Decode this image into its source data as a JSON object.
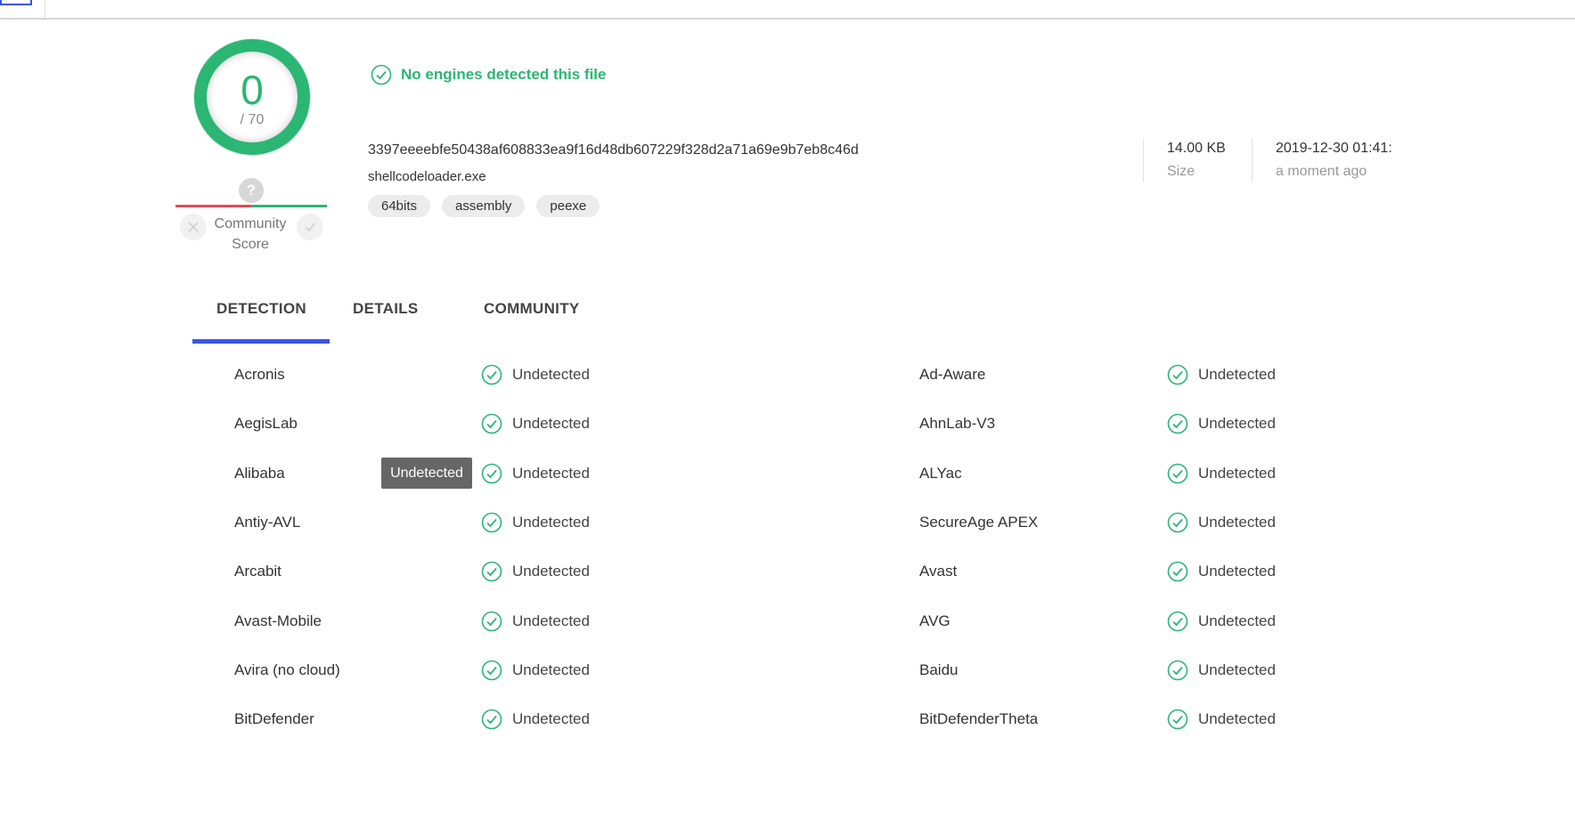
{
  "score": {
    "detected": "0",
    "total": "/ 70"
  },
  "community": {
    "label_line1": "Community",
    "label_line2": "Score",
    "question": "?"
  },
  "summary": {
    "message": "No engines detected this file"
  },
  "file": {
    "hash": "3397eeeebfe50438af608833ea9f16d48db607229f328d2a71a69e9b7eb8c46d",
    "name": "shellcodeloader.exe",
    "tags": [
      "64bits",
      "assembly",
      "peexe"
    ],
    "size_value": "14.00 KB",
    "size_label": "Size",
    "date_value": "2019-12-30 01:41:",
    "date_label": "a moment ago"
  },
  "tabs": [
    {
      "label": "DETECTION",
      "active": true
    },
    {
      "label": "DETAILS",
      "active": false
    },
    {
      "label": "COMMUNITY",
      "active": false
    }
  ],
  "tooltip": "Undetected",
  "detections": [
    {
      "left": {
        "engine": "Acronis",
        "result": "Undetected"
      },
      "right": {
        "engine": "Ad-Aware",
        "result": "Undetected"
      }
    },
    {
      "left": {
        "engine": "AegisLab",
        "result": "Undetected"
      },
      "right": {
        "engine": "AhnLab-V3",
        "result": "Undetected"
      }
    },
    {
      "left": {
        "engine": "Alibaba",
        "result": "Undetected"
      },
      "right": {
        "engine": "ALYac",
        "result": "Undetected"
      }
    },
    {
      "left": {
        "engine": "Antiy-AVL",
        "result": "Undetected"
      },
      "right": {
        "engine": "SecureAge APEX",
        "result": "Undetected"
      }
    },
    {
      "left": {
        "engine": "Arcabit",
        "result": "Undetected"
      },
      "right": {
        "engine": "Avast",
        "result": "Undetected"
      }
    },
    {
      "left": {
        "engine": "Avast-Mobile",
        "result": "Undetected"
      },
      "right": {
        "engine": "AVG",
        "result": "Undetected"
      }
    },
    {
      "left": {
        "engine": "Avira (no cloud)",
        "result": "Undetected"
      },
      "right": {
        "engine": "Baidu",
        "result": "Undetected"
      }
    },
    {
      "left": {
        "engine": "BitDefender",
        "result": "Undetected"
      },
      "right": {
        "engine": "BitDefenderTheta",
        "result": "Undetected"
      }
    }
  ],
  "colors": {
    "accent_green": "#2bb673",
    "tab_blue": "#3b55e6",
    "negative_red": "#e04a5a"
  }
}
